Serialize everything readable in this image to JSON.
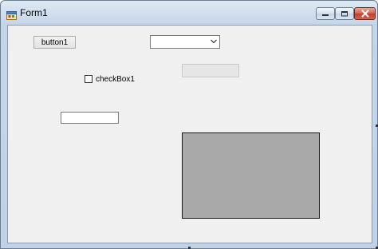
{
  "window": {
    "title": "Form1"
  },
  "form": {
    "button1_label": "button1",
    "combo_value": "",
    "checkbox_label": "checkBox1",
    "checkbox_checked": false,
    "textbox_value": ""
  },
  "icons": {
    "app": "form-icon",
    "minimize": "minimize-icon",
    "maximize": "maximize-icon",
    "close": "close-icon",
    "combo_arrow": "chevron-down-icon"
  },
  "colors": {
    "client_bg": "#f0f0f0",
    "panel_bg": "#a9a9a9",
    "close_button": "#c0402a"
  }
}
